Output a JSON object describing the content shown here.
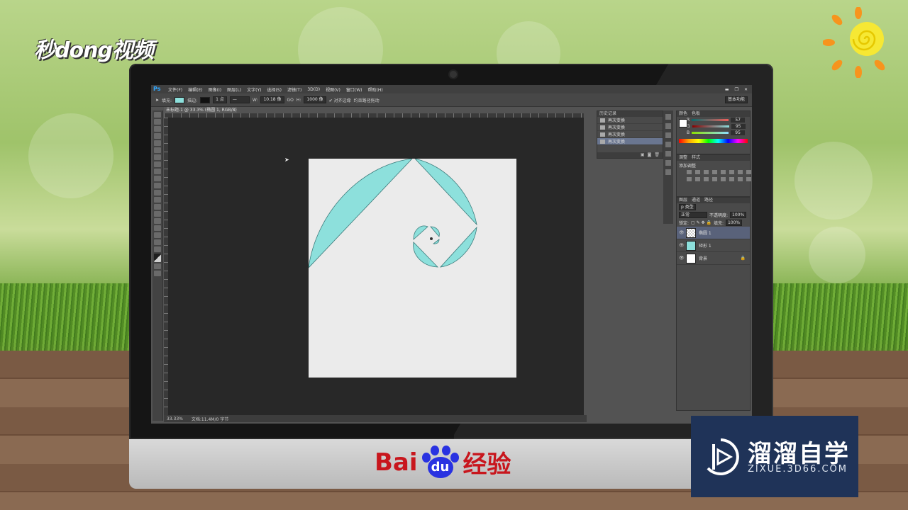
{
  "branding": {
    "top_logo": "秒dong视频",
    "baidu_bai": "Bai",
    "baidu_du": "du",
    "baidu_jy": "经验",
    "watermark_title": "溜溜自学",
    "watermark_url": "ZIXUE.3D66.COM"
  },
  "photoshop": {
    "logo": "Ps",
    "menu": [
      "文件(F)",
      "编辑(E)",
      "图像(I)",
      "图层(L)",
      "文字(Y)",
      "选择(S)",
      "滤镜(T)",
      "3D(D)",
      "视图(V)",
      "窗口(W)",
      "帮助(H)"
    ],
    "window_controls": [
      "▬",
      "❐",
      "✕"
    ],
    "options_bar": {
      "fill_label": "填充:",
      "stroke_label": "描边:",
      "stroke_width": "1 点",
      "w_label": "W:",
      "w_value": "10.18 像",
      "go_label": "GO",
      "h_label": "H:",
      "h_value": "1000 像",
      "align_edges": "✔ 对齐边缘",
      "constrain": "约束路径拖动",
      "workspace": "基本功能"
    },
    "document_tab": "未标题-1 @ 33.3% (椭圆 1, RGB/8) * ×",
    "status": {
      "zoom": "33.33%",
      "doc_info": "文档:11.4M/0 字节"
    },
    "history": {
      "tabs": [
        "历史记录"
      ],
      "rows": [
        "再次变换",
        "再次变换",
        "再次变换",
        "再次变换"
      ]
    },
    "color_panel": {
      "tabs": [
        "颜色",
        "色板"
      ],
      "r_label": "R",
      "r_value": "57",
      "g_label": "G",
      "g_value": "95",
      "b_label": "B",
      "b_value": "95"
    },
    "adjustments": {
      "tabs": [
        "调整",
        "样式"
      ],
      "title": "添加调整"
    },
    "layers": {
      "tabs": [
        "图层",
        "通道",
        "路径"
      ],
      "filter": "p 类型",
      "blend_mode": "正常",
      "opacity_label": "不透明度:",
      "opacity_value": "100%",
      "lock_label": "锁定:",
      "fill_label": "填充:",
      "fill_value": "100%",
      "items": [
        {
          "name": "椭圆 1",
          "thumb": "check",
          "active": true
        },
        {
          "name": "矩形 1",
          "thumb": "teal",
          "active": false
        },
        {
          "name": "背景",
          "thumb": "white",
          "active": false
        }
      ]
    },
    "shape_color": "#8de0dc",
    "document_bg": "#ebebeb"
  }
}
